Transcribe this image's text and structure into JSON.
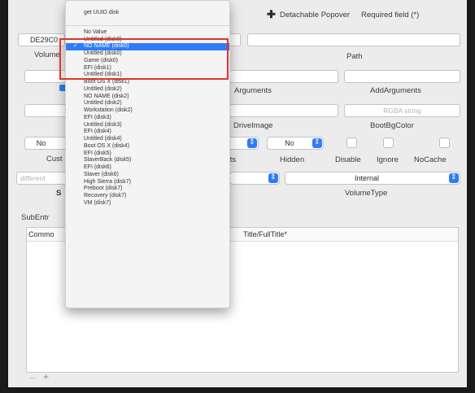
{
  "toolbar": {
    "detach_label": "Detachable Popover",
    "required_label": "Required field (*)"
  },
  "fields": {
    "volume_value": "DE29C0",
    "volume_label": "Volume",
    "path_label": "Path",
    "arguments_label": "Arguments",
    "addarguments_label": "AddArguments",
    "driveimage_label": "DriveImage",
    "bootbgcolor_label": "BootBgColor",
    "rgba_placeholder": "RGBA string",
    "custom_label": "Cust",
    "hidden_label": "Hidden",
    "hidden_value": "No",
    "left_popup_value": "No",
    "texts_label": "xts",
    "disable_label": "Disable",
    "ignore_label": "Ignore",
    "nocache_label": "NoCache",
    "different_placeholder": "different",
    "s_label": "S",
    "volumetype_label": "VolumeType",
    "volumetype_value": "Internal"
  },
  "subentries": {
    "label": "SubEntr",
    "columns": [
      "Commo",
      "Title/FullTitle*"
    ],
    "add_button": "+",
    "remove_button": "—"
  },
  "menu": {
    "header": "get UUID disk",
    "items": [
      "No Value",
      "Untitled (disk0)",
      "NO NAME (disk0)",
      "Untitled (disk0)",
      "Game (disk0)",
      "EFI (disk1)",
      "Untitled (disk1)",
      "Boot OS X (disk1)",
      "Untitled (disk2)",
      "NO NAME (disk2)",
      "Untitled (disk2)",
      "Workstation (disk2)",
      "EFI (disk3)",
      "Untitled (disk3)",
      "EFI (disk4)",
      "Untitled (disk4)",
      "Boot OS X (disk4)",
      "EFI (disk5)",
      "SlaverBack (disk5)",
      "EFI (disk6)",
      "Slaver (disk6)",
      "High Sierra (disk7)",
      "Preboot (disk7)",
      "Recovery (disk7)",
      "VM (disk7)"
    ],
    "selected_index": 2,
    "checkmark": "✓"
  },
  "colors": {
    "accent": "#2f7cf6",
    "highlight_box": "#e4322b"
  }
}
